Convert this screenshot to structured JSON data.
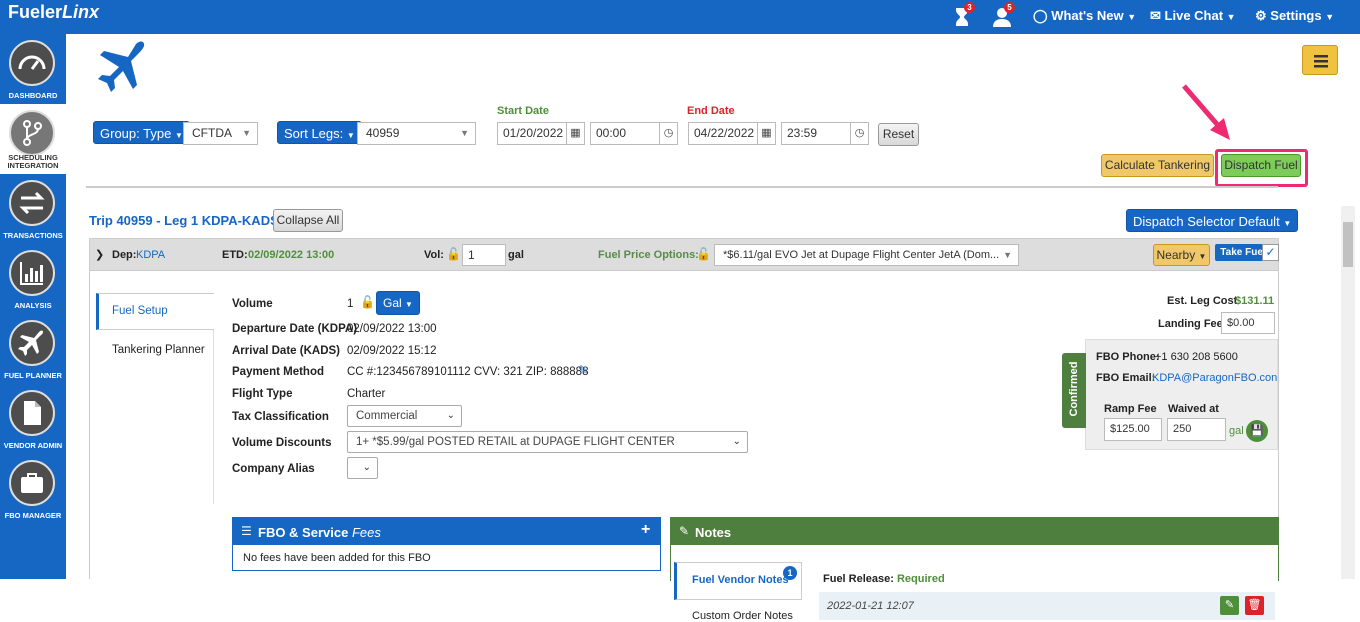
{
  "header": {
    "logo_main": "Fueler",
    "logo_italic": "Linx",
    "badge1": "3",
    "badge2": "5",
    "whats_new": "What's New",
    "live_chat": "Live Chat",
    "settings": "Settings"
  },
  "sidebar": {
    "items": [
      {
        "label": "DASHBOARD"
      },
      {
        "label": "SCHEDULING INTEGRATION"
      },
      {
        "label": "TRANSACTIONS"
      },
      {
        "label": "ANALYSIS"
      },
      {
        "label": "FUEL PLANNER"
      },
      {
        "label": "VENDOR ADMIN"
      },
      {
        "label": "FBO MANAGER"
      }
    ]
  },
  "filters": {
    "group_label": "Group: Type",
    "group_value": "CFTDA",
    "sort_label": "Sort Legs:",
    "sort_value": "40959",
    "start_date_label": "Start Date",
    "start_date": "01/20/2022",
    "start_time": "00:00",
    "end_date_label": "End Date",
    "end_date": "04/22/2022",
    "end_time": "23:59",
    "reset": "Reset"
  },
  "actions": {
    "calc_tankering": "Calculate Tankering",
    "dispatch_fuel": "Dispatch Fuel",
    "dispatch_selector": "Dispatch Selector Default"
  },
  "trip": {
    "title": "Trip 40959 - Leg 1 KDPA-KADS",
    "collapse": "Collapse All"
  },
  "dep_bar": {
    "dep_label": "Dep:",
    "dep_value": "KDPA",
    "etd_label": "ETD:",
    "etd_value": "02/09/2022 13:00",
    "vol_label": "Vol:",
    "vol_value": "1",
    "vol_unit": "gal",
    "fpo_label": "Fuel Price Options:",
    "fpo_value": "*$6.11/gal EVO Jet at Dupage Flight Center JetA (Dom...",
    "nearby": "Nearby",
    "take_fuel": "Take Fuel"
  },
  "tabs": {
    "fuel_setup": "Fuel Setup",
    "tankering": "Tankering Planner"
  },
  "details": {
    "volume_label": "Volume",
    "volume_value": "1",
    "volume_unit": "Gal",
    "dep_date_label": "Departure Date (KDPA)",
    "dep_date": "02/09/2022 13:00",
    "arr_date_label": "Arrival Date (KADS)",
    "arr_date": "02/09/2022 15:12",
    "payment_label": "Payment Method",
    "payment": "CC #:123456789101112 CVV: 321 ZIP: 888888",
    "flight_type_label": "Flight Type",
    "flight_type": "Charter",
    "tax_label": "Tax Classification",
    "tax": "Commercial",
    "vol_disc_label": "Volume Discounts",
    "vol_disc": "1+ *$5.99/gal POSTED RETAIL at DUPAGE FLIGHT CENTER",
    "alias_label": "Company Alias"
  },
  "right": {
    "est_cost_label": "Est. Leg Cost",
    "est_cost": "$131.11",
    "landing_label": "Landing Fee",
    "landing_value": "$0.00",
    "confirmed": "Confirmed",
    "fbo_phone_label": "FBO Phone:",
    "fbo_phone": "+1 630 208 5600",
    "fbo_email_label": "FBO Email:",
    "fbo_email": "KDPA@ParagonFBO.con",
    "ramp_label": "Ramp Fee",
    "ramp_value": "$125.00",
    "waived_label": "Waived at",
    "waived_value": "250",
    "waived_unit": "gal"
  },
  "fees": {
    "title": "FBO & Service ",
    "title_italic": "Fees",
    "empty": "No fees have been added for this FBO",
    "plus": "+"
  },
  "notes": {
    "title": "Notes",
    "vendor_notes": "Fuel Vendor Notes",
    "vendor_badge": "1",
    "custom_notes": "Custom Order Notes",
    "release_label": "Fuel Release:",
    "release_value": "Required",
    "note_date": "2022-01-21 12:07"
  }
}
